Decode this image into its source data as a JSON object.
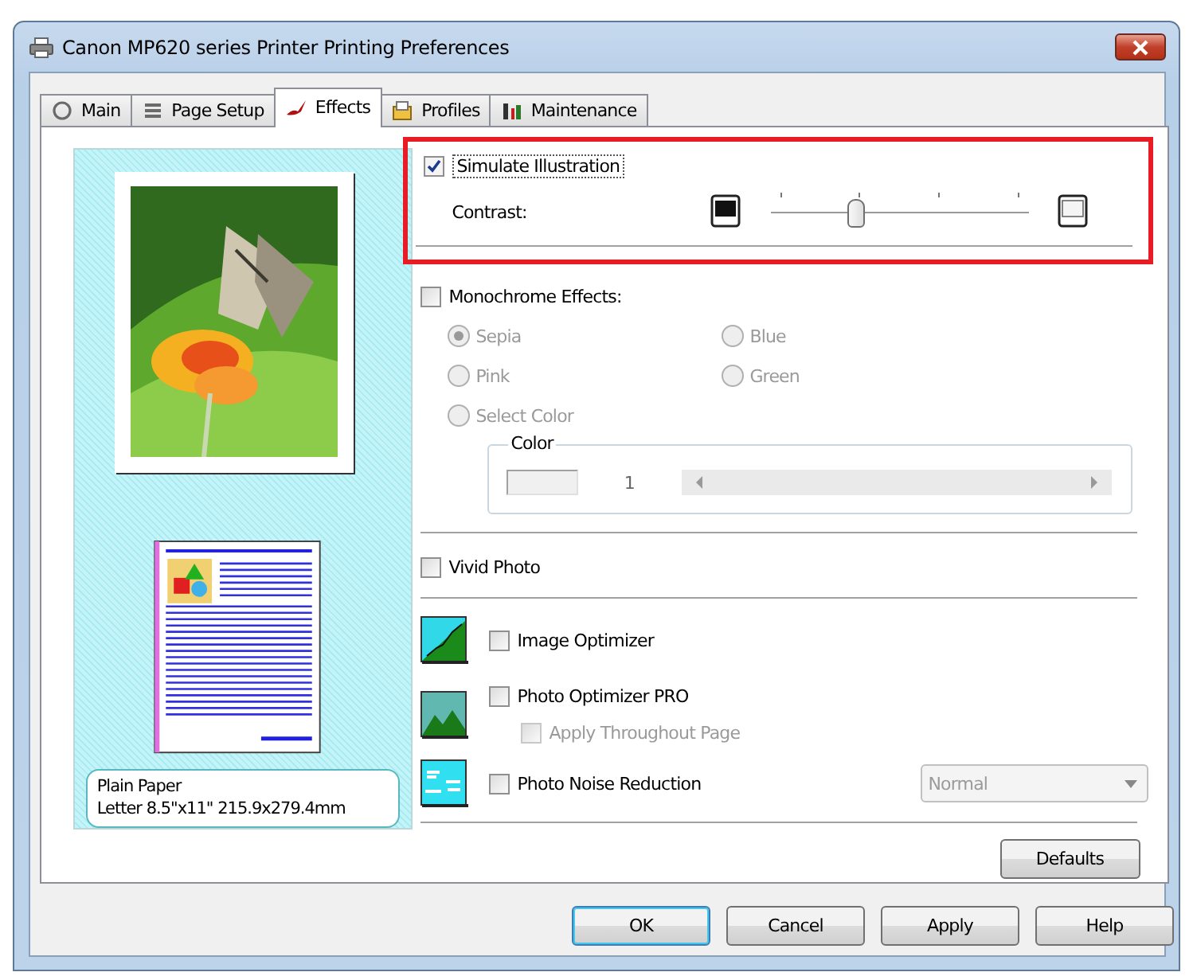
{
  "window": {
    "title": "Canon MP620 series Printer Printing Preferences"
  },
  "tabs": [
    {
      "label": "Main",
      "selected": false,
      "kind": "main"
    },
    {
      "label": "Page Setup",
      "selected": false,
      "kind": "setup"
    },
    {
      "label": "Effects",
      "selected": true,
      "kind": "effects"
    },
    {
      "label": "Profiles",
      "selected": false,
      "kind": "profiles"
    },
    {
      "label": "Maintenance",
      "selected": false,
      "kind": "maintenance"
    }
  ],
  "preview": {
    "media": "Plain Paper",
    "size": "Letter 8.5\"x11\" 215.9x279.4mm"
  },
  "simulate_illustration": {
    "label": "Simulate Illustration",
    "checked": true,
    "highlighted": true,
    "contrast": {
      "label": "Contrast:",
      "level": 0.33
    }
  },
  "monochrome_effects": {
    "label": "Monochrome Effects:",
    "checked": false,
    "disabled": true,
    "options": [
      {
        "label": "Sepia",
        "selected": true
      },
      {
        "label": "Blue",
        "selected": false
      },
      {
        "label": "Pink",
        "selected": false
      },
      {
        "label": "Green",
        "selected": false
      },
      {
        "label": "Select Color",
        "selected": false
      }
    ],
    "color_group": {
      "title": "Color",
      "value": "1"
    }
  },
  "vivid_photo": {
    "label": "Vivid Photo",
    "checked": false
  },
  "image_optimizer": {
    "label": "Image Optimizer",
    "checked": false
  },
  "photo_optimizer_pro": {
    "label": "Photo Optimizer PRO",
    "checked": false,
    "apply_throughout": {
      "label": "Apply Throughout Page",
      "checked": false,
      "disabled": true
    }
  },
  "photo_noise_reduction": {
    "label": "Photo Noise Reduction",
    "checked": false,
    "select": {
      "value": "Normal",
      "disabled": true
    }
  },
  "defaults_button": "Defaults",
  "buttons": [
    {
      "label": "OK",
      "kind": "default"
    },
    {
      "label": "Cancel",
      "kind": "normal"
    },
    {
      "label": "Apply",
      "kind": "normal"
    },
    {
      "label": "Help",
      "kind": "normal"
    }
  ]
}
